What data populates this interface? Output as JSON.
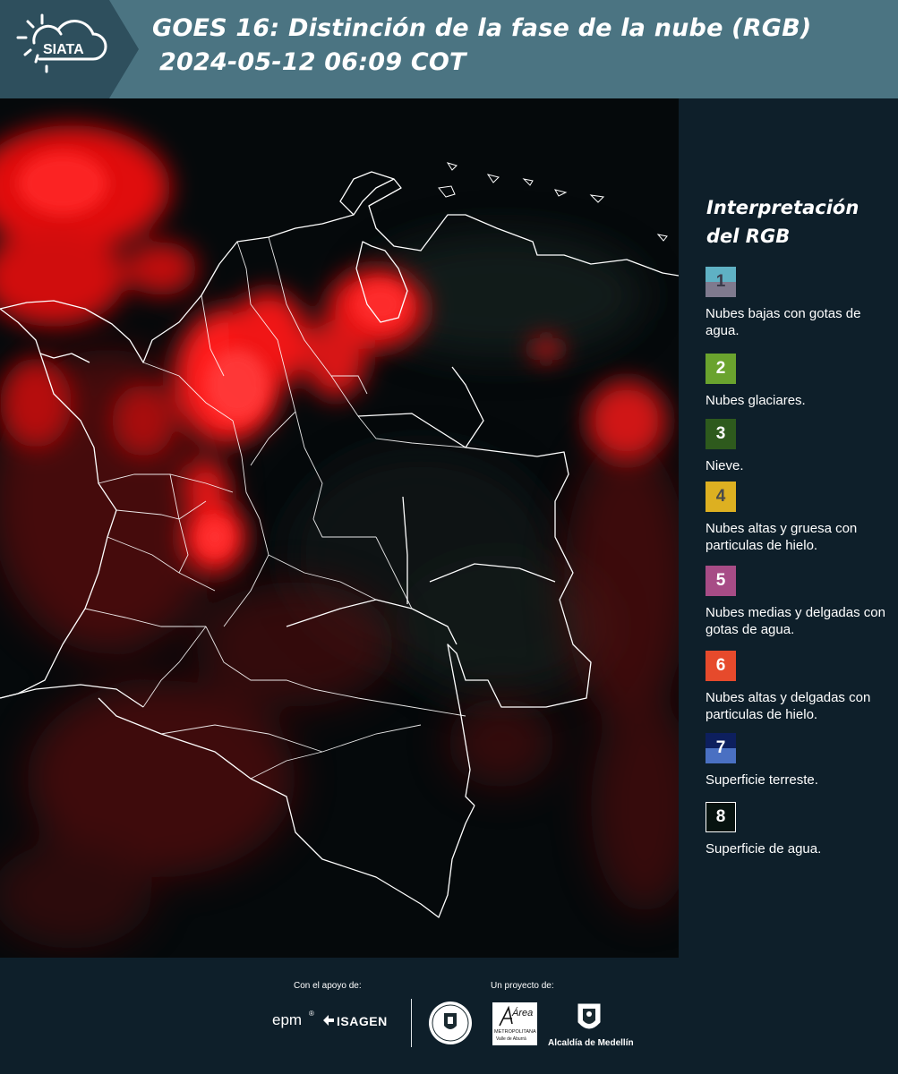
{
  "header": {
    "logo_text": "SIATA",
    "title_line1": "GOES 16: Distinción de la fase de la nube (RGB)",
    "title_line2": "2024-05-12 06:09 COT"
  },
  "legend": {
    "title": "Interpretación del RGB",
    "items": [
      {
        "number": "1",
        "label": "Nubes bajas con gotas de agua.",
        "colors": [
          "#5fb1c4",
          "#7f7a8e"
        ],
        "text_color": "#3a3a4a"
      },
      {
        "number": "2",
        "label": "Nubes glaciares.",
        "colors": [
          "#6aa32e"
        ],
        "text_color": "#ffffff"
      },
      {
        "number": "3",
        "label": "Nieve.",
        "colors": [
          "#2e5a1d"
        ],
        "text_color": "#ffffff"
      },
      {
        "number": "4",
        "label": "Nubes altas y gruesa con particulas de hielo.",
        "colors": [
          "#ddb021"
        ],
        "text_color": "#4a4a4a"
      },
      {
        "number": "5",
        "label": "Nubes medias y delgadas con gotas de agua.",
        "colors": [
          "#a74c86"
        ],
        "text_color": "#ffffff"
      },
      {
        "number": "6",
        "label": "Nubes altas y delgadas con particulas de hielo.",
        "colors": [
          "#e64a2c"
        ],
        "text_color": "#ffffff"
      },
      {
        "number": "7",
        "label": "Superficie terreste.",
        "colors": [
          "#0d1f5e",
          "#4a70c2"
        ],
        "text_color": "#ffffff"
      },
      {
        "number": "8",
        "label": "Superficie de agua.",
        "colors": [
          "#071310"
        ],
        "text_color": "#ffffff",
        "border": "#ffffff"
      }
    ]
  },
  "footer": {
    "support_label": "Con el apoyo de:",
    "project_label": "Un proyecto de:",
    "epm_text": "epm",
    "isagen_text": "ISAGEN",
    "area_text": "Área",
    "area_subtext1": "METROPOLITANA",
    "area_subtext2": "Valle de Aburrá",
    "medellin_text": "Alcaldía de Medellín"
  },
  "colors": {
    "header_bg": "#4b7482",
    "panel_bg": "#0e1f2a",
    "cloud_red": "#ff1a1a"
  }
}
